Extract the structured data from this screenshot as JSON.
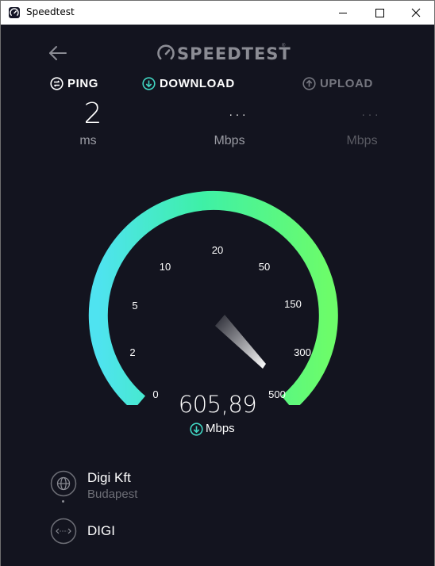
{
  "window": {
    "title": "Speedtest"
  },
  "header": {
    "logo_text": "SPEEDTEST",
    "logo_tm": "®"
  },
  "metrics": {
    "ping": {
      "label": "PING",
      "value": "2",
      "unit": "ms"
    },
    "download": {
      "label": "DOWNLOAD",
      "value": "...",
      "unit": "Mbps"
    },
    "upload": {
      "label": "UPLOAD",
      "value": "...",
      "unit": "Mbps"
    }
  },
  "gauge": {
    "ticks": [
      "0",
      "2",
      "5",
      "10",
      "20",
      "50",
      "150",
      "300",
      "500"
    ],
    "current_value": "605,89",
    "unit": "Mbps",
    "gradient_start": "#4fe3f0",
    "gradient_mid": "#3ef0a7",
    "gradient_end": "#6cfc6a"
  },
  "server": {
    "provider": "Digi Kft",
    "location": "Budapest",
    "host": "DIGI"
  },
  "colors": {
    "background": "#13141f",
    "accent_teal": "#41d6c3",
    "muted": "#6d6e76"
  },
  "icons": {
    "back": "arrow-left-icon",
    "ping": "ping-icon",
    "download": "download-icon",
    "upload": "upload-icon",
    "provider": "globe-icon",
    "host": "server-icon"
  }
}
